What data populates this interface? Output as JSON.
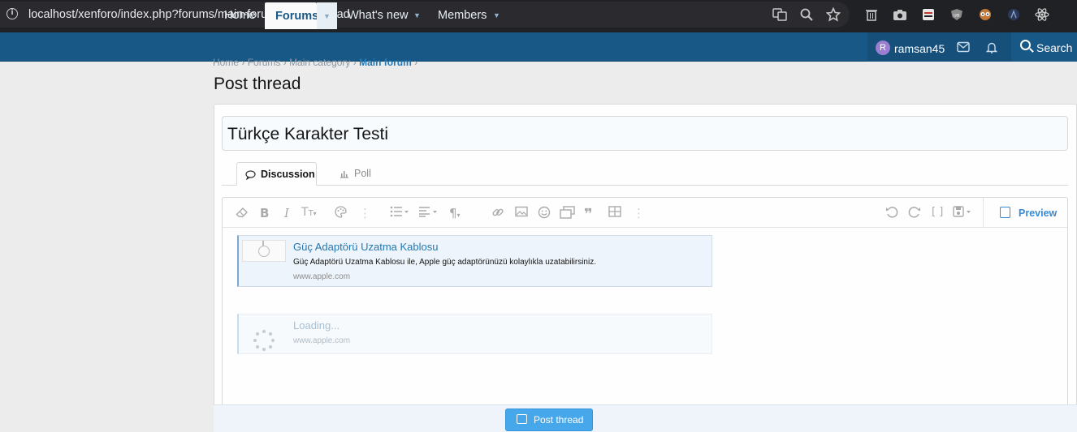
{
  "browser": {
    "url": "localhost/xenforo/index.php?forums/main-forum.2/post-thread",
    "info_icon_glyph": "i"
  },
  "nav": {
    "home": "Home",
    "forums": "Forums",
    "whats_new": "What's new",
    "members": "Members",
    "avatar_letter": "R",
    "username": "ramsan45",
    "search": "Search"
  },
  "breadcrumb": {
    "items": [
      "Home",
      "Forums",
      "Main category",
      "Main forum"
    ],
    "separator": "›"
  },
  "page": {
    "title": "Post thread"
  },
  "form": {
    "thread_title_value": "Türkçe Karakter Testi",
    "tab_discussion": "Discussion",
    "tab_poll": "Poll",
    "preview": "Preview",
    "post_button": "Post thread"
  },
  "cards": [
    {
      "title": "Güç Adaptörü Uzatma Kablosu",
      "description": "Güç Adaptörü Uzatma Kablosu ile, Apple güç adaptörünüzü kolaylıkla uzatabilirsiniz.",
      "url": "www.apple.com"
    },
    {
      "title": "Loading...",
      "url": "www.apple.com"
    }
  ],
  "colors": {
    "nav_bg": "#185886",
    "accent": "#2577b1",
    "button": "#47a7eb"
  }
}
